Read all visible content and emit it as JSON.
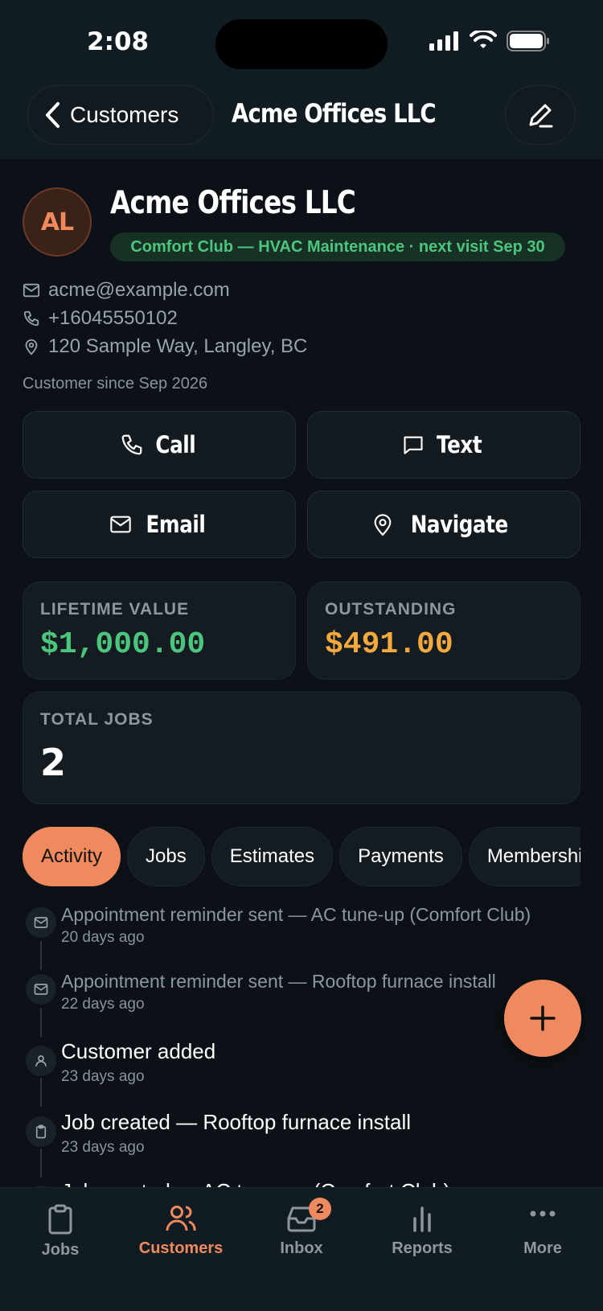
{
  "status_bar": {
    "time": "2:08"
  },
  "nav": {
    "back_label": "Customers",
    "title": "Acme Offices LLC"
  },
  "customer": {
    "initials": "AL",
    "name": "Acme Offices LLC",
    "membership": "Comfort Club — HVAC Maintenance · next visit Sep 30",
    "email": "acme@example.com",
    "phone": "+16045550102",
    "address": "120 Sample Way, Langley, BC",
    "since": "Customer since Sep 2026"
  },
  "actions": {
    "call": "Call",
    "text": "Text",
    "email": "Email",
    "navigate": "Navigate"
  },
  "stats": {
    "lifetime_label": "LIFETIME VALUE",
    "lifetime_value": "$1,000.00",
    "outstanding_label": "OUTSTANDING",
    "outstanding_value": "$491.00",
    "jobs_label": "TOTAL JOBS",
    "jobs_value": "2"
  },
  "tabs": [
    "Activity",
    "Jobs",
    "Estimates",
    "Payments",
    "Membershi"
  ],
  "activity": [
    {
      "title": "Appointment reminder sent — AC tune-up (Comfort Club)",
      "time": "20 days ago"
    },
    {
      "title": "Appointment reminder sent — Rooftop furnace install",
      "time": "22 days ago"
    },
    {
      "title": "Customer added",
      "time": "23 days ago"
    },
    {
      "title": "Job created — Rooftop furnace install",
      "time": "23 days ago"
    },
    {
      "title": "Job created — AC tune-up (Comfort Club)",
      "time": ""
    }
  ],
  "tab_bar": {
    "jobs": "Jobs",
    "customers": "Customers",
    "inbox": "Inbox",
    "inbox_badge": "2",
    "reports": "Reports",
    "more": "More"
  },
  "colors": {
    "accent": "#ef8a5e",
    "positive": "#4cc67e",
    "warning": "#f4a93c",
    "background": "#0b1116"
  }
}
